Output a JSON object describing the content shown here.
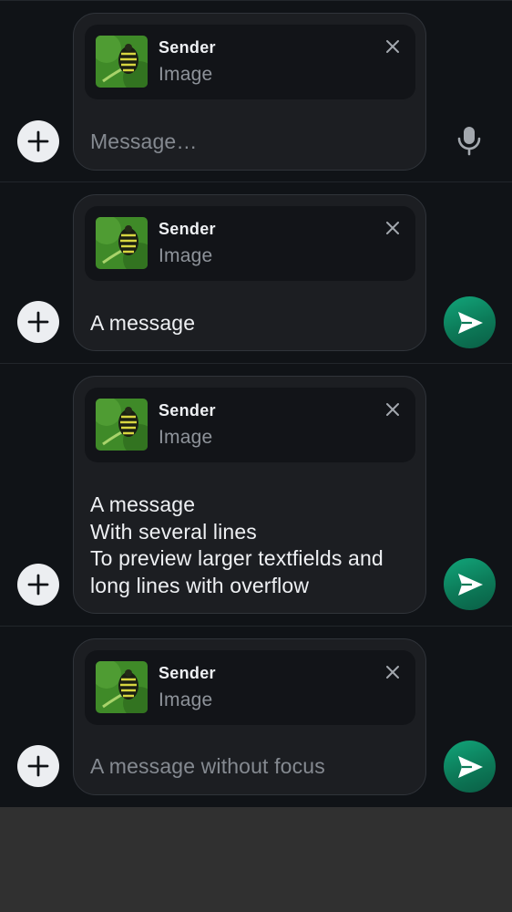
{
  "composers": [
    {
      "reply": {
        "sender": "Sender",
        "kind": "Image"
      },
      "text": "Message…",
      "text_is_placeholder": true,
      "action": "microphone"
    },
    {
      "reply": {
        "sender": "Sender",
        "kind": "Image"
      },
      "text": "A message",
      "text_is_placeholder": false,
      "action": "send"
    },
    {
      "reply": {
        "sender": "Sender",
        "kind": "Image"
      },
      "text": "A message\nWith several lines\nTo preview larger textfields and long lines with overflow",
      "text_is_placeholder": false,
      "action": "send"
    },
    {
      "reply": {
        "sender": "Sender",
        "kind": "Image"
      },
      "text": "A message without focus",
      "text_is_placeholder": true,
      "action": "send"
    }
  ],
  "icons": {
    "attach": "plus-icon",
    "remove_reply": "close-icon",
    "voice": "microphone-icon",
    "send": "send-icon",
    "thumbnail": "image-thumbnail"
  },
  "colors": {
    "background": "#101317",
    "field": "#1c1e22",
    "reply_panel": "#121418",
    "send_accent": "#0c7a58",
    "attach_button": "#eceef1"
  }
}
